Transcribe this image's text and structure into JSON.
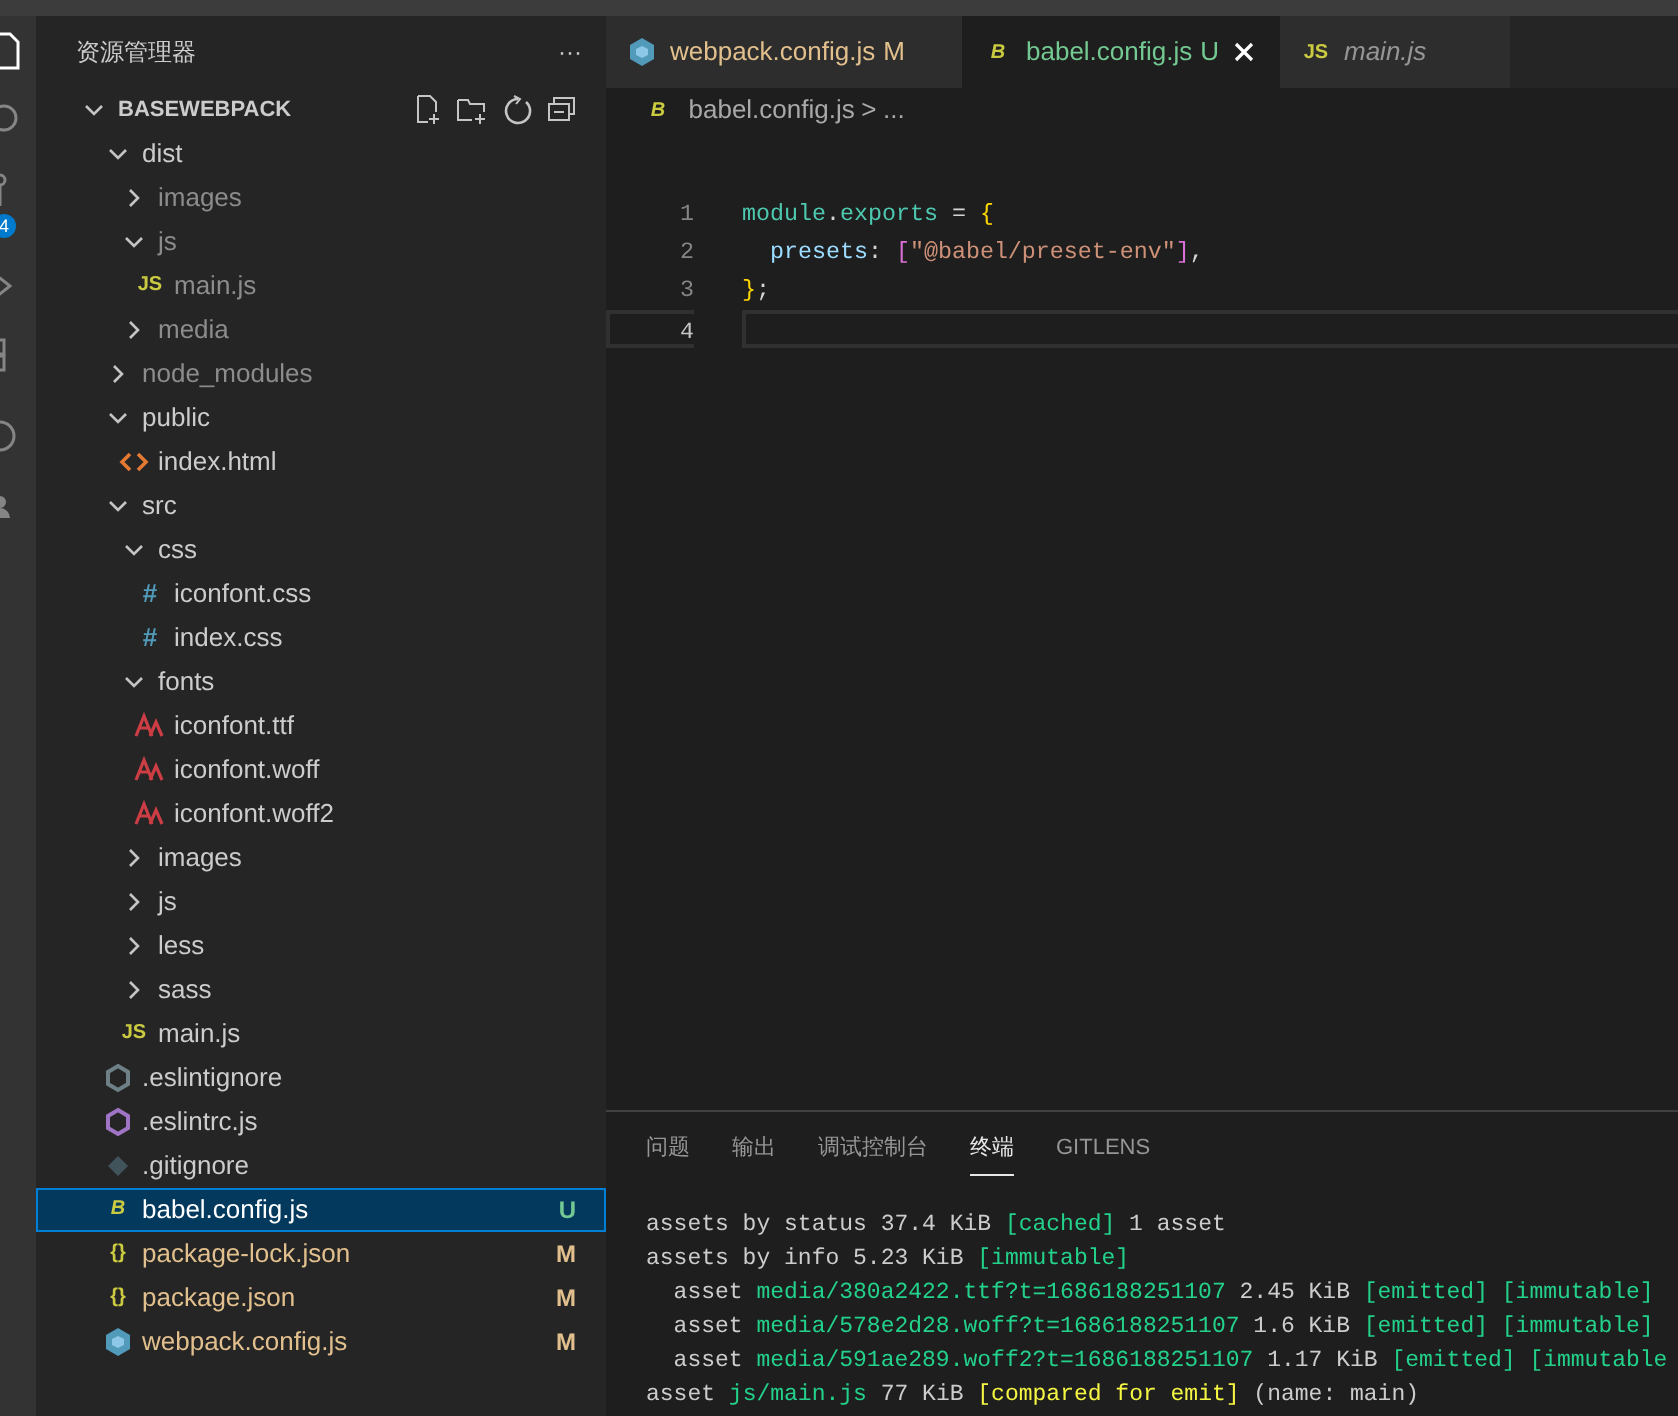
{
  "activity_bar": {
    "badge": "4"
  },
  "sidebar": {
    "title": "资源管理器",
    "more": "···",
    "root": {
      "label": "BASEWEBPACK",
      "expanded": true
    },
    "tree": [
      {
        "label": "dist",
        "kind": "folder",
        "expanded": true,
        "ignored": false,
        "children": [
          {
            "label": "images",
            "kind": "folder",
            "expanded": false,
            "ignored": true
          },
          {
            "label": "js",
            "kind": "folder",
            "expanded": true,
            "ignored": true,
            "children": [
              {
                "label": "main.js",
                "kind": "js",
                "icon_text": "JS",
                "ignored": true
              }
            ]
          },
          {
            "label": "media",
            "kind": "folder",
            "expanded": false,
            "ignored": true
          }
        ]
      },
      {
        "label": "node_modules",
        "kind": "folder",
        "expanded": false,
        "ignored": true
      },
      {
        "label": "public",
        "kind": "folder",
        "expanded": true,
        "ignored": false,
        "children": [
          {
            "label": "index.html",
            "kind": "html",
            "ignored": false
          }
        ]
      },
      {
        "label": "src",
        "kind": "folder",
        "expanded": true,
        "ignored": false,
        "children": [
          {
            "label": "css",
            "kind": "folder",
            "expanded": true,
            "ignored": false,
            "children": [
              {
                "label": "iconfont.css",
                "kind": "css",
                "icon_text": "#",
                "ignored": false
              },
              {
                "label": "index.css",
                "kind": "css",
                "icon_text": "#",
                "ignored": false
              }
            ]
          },
          {
            "label": "fonts",
            "kind": "folder",
            "expanded": true,
            "ignored": false,
            "children": [
              {
                "label": "iconfont.ttf",
                "kind": "font",
                "ignored": false
              },
              {
                "label": "iconfont.woff",
                "kind": "font",
                "ignored": false
              },
              {
                "label": "iconfont.woff2",
                "kind": "font",
                "ignored": false
              }
            ]
          },
          {
            "label": "images",
            "kind": "folder",
            "expanded": false,
            "ignored": false
          },
          {
            "label": "js",
            "kind": "folder",
            "expanded": false,
            "ignored": false
          },
          {
            "label": "less",
            "kind": "folder",
            "expanded": false,
            "ignored": false
          },
          {
            "label": "sass",
            "kind": "folder",
            "expanded": false,
            "ignored": false
          },
          {
            "label": "main.js",
            "kind": "js",
            "icon_text": "JS",
            "ignored": false
          }
        ]
      },
      {
        "label": ".eslintignore",
        "kind": "eslintignore",
        "ignored": false
      },
      {
        "label": ".eslintrc.js",
        "kind": "eslintrc",
        "ignored": false
      },
      {
        "label": ".gitignore",
        "kind": "git",
        "ignored": false
      },
      {
        "label": "babel.config.js",
        "kind": "babel",
        "icon_text": "B",
        "ignored": false,
        "selected": true,
        "status": "U"
      },
      {
        "label": "package-lock.json",
        "kind": "json",
        "icon_text": "{}",
        "ignored": false,
        "status": "M"
      },
      {
        "label": "package.json",
        "kind": "json",
        "icon_text": "{}",
        "ignored": false,
        "status": "M"
      },
      {
        "label": "webpack.config.js",
        "kind": "webpack",
        "ignored": false,
        "status": "M"
      }
    ]
  },
  "tabs": [
    {
      "label": "webpack.config.js",
      "kind": "webpack",
      "status": "M",
      "selected": false,
      "preview": false
    },
    {
      "label": "babel.config.js",
      "kind": "babel",
      "icon_text": "B",
      "status": "U",
      "selected": true,
      "preview": false
    },
    {
      "label": "main.js",
      "kind": "js",
      "icon_text": "JS",
      "selected": false,
      "preview": true
    }
  ],
  "breadcrumb": {
    "icon_text": "B",
    "file": "babel.config.js",
    "separator": ">",
    "more": "..."
  },
  "editor": {
    "lines": [
      {
        "number": "1",
        "tokens": [
          {
            "text": "module",
            "color": "#4ec9b0"
          },
          {
            "text": ".",
            "color": "#d4d4d4"
          },
          {
            "text": "exports",
            "color": "#4ec9b0"
          },
          {
            "text": " = ",
            "color": "#d4d4d4"
          },
          {
            "text": "{",
            "color": "#ffd700"
          }
        ]
      },
      {
        "number": "2",
        "tokens": [
          {
            "text": "  presets",
            "color": "#9cdcfe"
          },
          {
            "text": ": ",
            "color": "#d4d4d4"
          },
          {
            "text": "[",
            "color": "#da70d6"
          },
          {
            "text": "\"@babel/preset-env\"",
            "color": "#ce9178"
          },
          {
            "text": "]",
            "color": "#da70d6"
          },
          {
            "text": ",",
            "color": "#d4d4d4"
          }
        ]
      },
      {
        "number": "3",
        "tokens": [
          {
            "text": "}",
            "color": "#ffd700"
          },
          {
            "text": ";",
            "color": "#d4d4d4"
          }
        ]
      },
      {
        "number": "4",
        "current": true
      }
    ]
  },
  "panel": {
    "tabs": [
      {
        "label": "问题",
        "selected": false
      },
      {
        "label": "输出",
        "selected": false
      },
      {
        "label": "调试控制台",
        "selected": false
      },
      {
        "label": "终端",
        "selected": true
      },
      {
        "label": "GITLENS",
        "selected": false
      }
    ],
    "terminal": [
      [
        {
          "text": "assets by status 37.4 KiB ",
          "color": "#cccccc"
        },
        {
          "text": "[cached]",
          "color": "#23d18b"
        },
        {
          "text": " 1 asset",
          "color": "#cccccc"
        }
      ],
      [
        {
          "text": "assets by info 5.23 KiB ",
          "color": "#cccccc"
        },
        {
          "text": "[immutable]",
          "color": "#23d18b"
        }
      ],
      [
        {
          "text": "  asset ",
          "color": "#cccccc"
        },
        {
          "text": "media/380a2422.ttf?t=1686188251107",
          "color": "#23d18b"
        },
        {
          "text": " 2.45 KiB ",
          "color": "#cccccc"
        },
        {
          "text": "[emitted] [immutable]",
          "color": "#23d18b"
        }
      ],
      [
        {
          "text": "  asset ",
          "color": "#cccccc"
        },
        {
          "text": "media/578e2d28.woff?t=1686188251107",
          "color": "#23d18b"
        },
        {
          "text": " 1.6 KiB ",
          "color": "#cccccc"
        },
        {
          "text": "[emitted] [immutable]",
          "color": "#23d18b"
        }
      ],
      [
        {
          "text": "  asset ",
          "color": "#cccccc"
        },
        {
          "text": "media/591ae289.woff2?t=1686188251107",
          "color": "#23d18b"
        },
        {
          "text": " 1.17 KiB ",
          "color": "#cccccc"
        },
        {
          "text": "[emitted] [immutable",
          "color": "#23d18b"
        }
      ],
      [
        {
          "text": "asset ",
          "color": "#cccccc"
        },
        {
          "text": "js/main.js",
          "color": "#23d18b"
        },
        {
          "text": " 77 KiB ",
          "color": "#cccccc"
        },
        {
          "text": "[compared for emit]",
          "color": "#f5f543"
        },
        {
          "text": " (name: main)",
          "color": "#cccccc"
        }
      ]
    ]
  }
}
